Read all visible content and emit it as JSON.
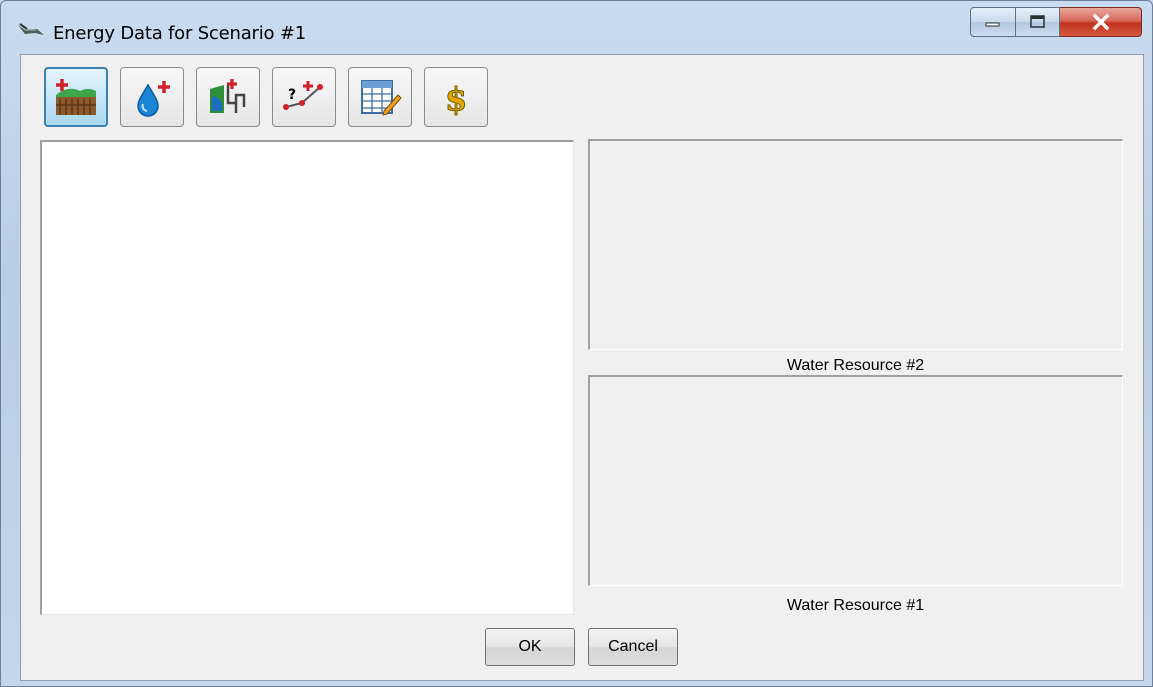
{
  "window": {
    "title": "Energy Data for Scenario #1",
    "icon": "app-icon",
    "controls": [
      "minimize-icon",
      "maximize-icon",
      "close-icon"
    ]
  },
  "toolbar": {
    "buttons": [
      {
        "name": "add-field-icon",
        "active": true
      },
      {
        "name": "add-water-icon",
        "active": false
      },
      {
        "name": "add-pipeline-icon",
        "active": false
      },
      {
        "name": "add-unknown-link-icon",
        "active": false
      },
      {
        "name": "edit-table-icon",
        "active": false
      },
      {
        "name": "cost-dollar-icon",
        "active": false
      }
    ]
  },
  "panels": {
    "top_label": "Water Resource #2",
    "bottom_label": "Water Resource #1"
  },
  "buttons": {
    "ok": "OK",
    "cancel": "Cancel"
  },
  "colors": {
    "frame": "#c5d7ea",
    "client": "#f0f0f0",
    "close_red": "#c2331f",
    "active_tool": "#3c7fb1"
  }
}
